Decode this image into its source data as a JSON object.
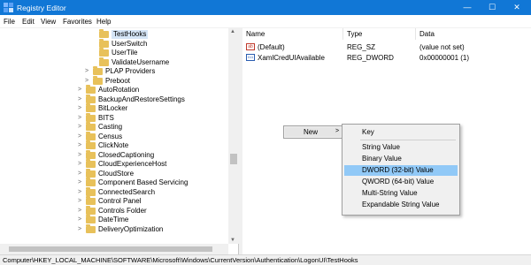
{
  "window": {
    "title": "Registry Editor",
    "controls": [
      "—",
      "☐",
      "✕"
    ],
    "accent": "#1177d6"
  },
  "menu": [
    "File",
    "Edit",
    "View",
    "Favorites",
    "Help"
  ],
  "tree": {
    "rows": [
      {
        "label": "TestHooks",
        "level": 2,
        "expander": "",
        "selected": true
      },
      {
        "label": "UserSwitch",
        "level": 2,
        "expander": "",
        "selected": false
      },
      {
        "label": "UserTile",
        "level": 2,
        "expander": "",
        "selected": false
      },
      {
        "label": "ValidateUsername",
        "level": 2,
        "expander": "",
        "selected": false
      },
      {
        "label": "PLAP Providers",
        "level": 1,
        "expander": ">",
        "selected": false
      },
      {
        "label": "Preboot",
        "level": 1,
        "expander": ">",
        "selected": false
      },
      {
        "label": "AutoRotation",
        "level": 0,
        "expander": ">",
        "selected": false
      },
      {
        "label": "BackupAndRestoreSettings",
        "level": 0,
        "expander": ">",
        "selected": false
      },
      {
        "label": "BitLocker",
        "level": 0,
        "expander": ">",
        "selected": false
      },
      {
        "label": "BITS",
        "level": 0,
        "expander": ">",
        "selected": false
      },
      {
        "label": "Casting",
        "level": 0,
        "expander": ">",
        "selected": false
      },
      {
        "label": "Census",
        "level": 0,
        "expander": ">",
        "selected": false
      },
      {
        "label": "ClickNote",
        "level": 0,
        "expander": ">",
        "selected": false
      },
      {
        "label": "ClosedCaptioning",
        "level": 0,
        "expander": ">",
        "selected": false
      },
      {
        "label": "CloudExperienceHost",
        "level": 0,
        "expander": ">",
        "selected": false
      },
      {
        "label": "CloudStore",
        "level": 0,
        "expander": ">",
        "selected": false
      },
      {
        "label": "Component Based Servicing",
        "level": 0,
        "expander": ">",
        "selected": false
      },
      {
        "label": "ConnectedSearch",
        "level": 0,
        "expander": ">",
        "selected": false
      },
      {
        "label": "Control Panel",
        "level": 0,
        "expander": ">",
        "selected": false
      },
      {
        "label": "Controls Folder",
        "level": 0,
        "expander": ">",
        "selected": false
      },
      {
        "label": "DateTime",
        "level": 0,
        "expander": ">",
        "selected": false
      },
      {
        "label": "DeliveryOptimization",
        "level": 0,
        "expander": ">",
        "selected": false
      }
    ]
  },
  "values_pane": {
    "headers": [
      "Name",
      "Type",
      "Data"
    ],
    "rows": [
      {
        "name": "(Default)",
        "type": "REG_SZ",
        "data": "(value not set)",
        "icon": "string-value-icon"
      },
      {
        "name": "XamlCredUIAvailable",
        "type": "REG_DWORD",
        "data": "0x00000001 (1)",
        "icon": "binary-value-icon"
      }
    ]
  },
  "context_menu": {
    "new_label": "New",
    "chevron": ">"
  },
  "submenu": {
    "items": [
      {
        "label": "Key",
        "highlighted": false
      },
      {
        "label": "String Value",
        "highlighted": false
      },
      {
        "label": "Binary Value",
        "highlighted": false
      },
      {
        "label": "DWORD (32-bit) Value",
        "highlighted": true
      },
      {
        "label": "QWORD (64-bit) Value",
        "highlighted": false
      },
      {
        "label": "Multi-String Value",
        "highlighted": false
      },
      {
        "label": "Expandable String Value",
        "highlighted": false
      }
    ],
    "highlight_color": "#91c9f7"
  },
  "status": {
    "path": "Computer\\HKEY_LOCAL_MACHINE\\SOFTWARE\\Microsoft\\Windows\\CurrentVersion\\Authentication\\LogonUI\\TestHooks"
  }
}
